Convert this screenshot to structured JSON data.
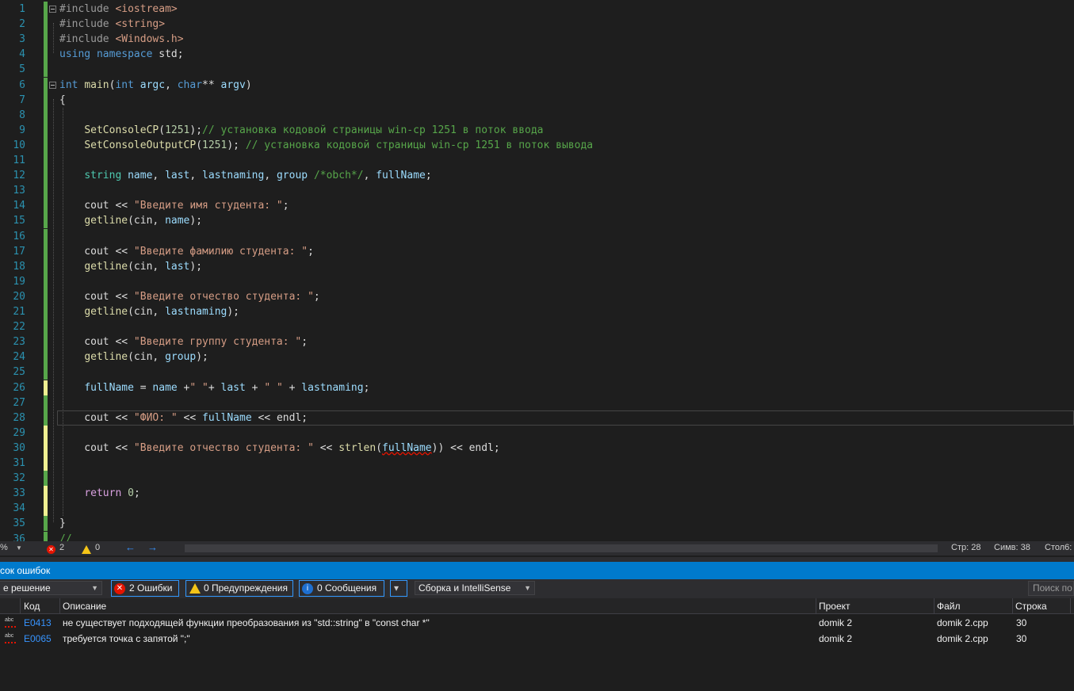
{
  "editor": {
    "lines": [
      {
        "n": "1",
        "html": "<span class=\"pp\">#include</span> <span class=\"str\">&lt;iostream&gt;</span>"
      },
      {
        "n": "2",
        "html": "<span class=\"pp\">#include</span> <span class=\"str\">&lt;string&gt;</span>"
      },
      {
        "n": "3",
        "html": "<span class=\"pp\">#include</span> <span class=\"str\">&lt;Windows.h&gt;</span>"
      },
      {
        "n": "4",
        "html": "<span class=\"kw\">using</span> <span class=\"kw\">namespace</span> std;"
      },
      {
        "n": "5",
        "html": ""
      },
      {
        "n": "6",
        "html": "<span class=\"kw\">int</span> <span class=\"fn\">main</span>(<span class=\"kw\">int</span> <span class=\"var\">argc</span>, <span class=\"kw\">char</span>** <span class=\"var\">argv</span>)"
      },
      {
        "n": "7",
        "html": "{"
      },
      {
        "n": "8",
        "html": ""
      },
      {
        "n": "9",
        "html": "    <span class=\"fn\">SetConsoleCP</span>(<span class=\"num\">1251</span>);<span class=\"cm\">// установка кодовой страницы win-cp 1251 в поток ввода</span>"
      },
      {
        "n": "10",
        "html": "    <span class=\"fn\">SetConsoleOutputCP</span>(<span class=\"num\">1251</span>); <span class=\"cm\">// установка кодовой страницы win-cp 1251 в поток вывода</span>"
      },
      {
        "n": "11",
        "html": ""
      },
      {
        "n": "12",
        "html": "    <span class=\"ty\">string</span> <span class=\"var\">name</span>, <span class=\"var\">last</span>, <span class=\"var\">lastnaming</span>, <span class=\"var\">group</span> <span class=\"cm\">/*obch*/</span>, <span class=\"var\">fullName</span>;"
      },
      {
        "n": "13",
        "html": ""
      },
      {
        "n": "14",
        "html": "    cout &lt;&lt; <span class=\"str\">\"Введите имя студента: \"</span>;"
      },
      {
        "n": "15",
        "html": "    <span class=\"fn\">getline</span>(cin, <span class=\"var\">name</span>);"
      },
      {
        "n": "16",
        "html": ""
      },
      {
        "n": "17",
        "html": "    cout &lt;&lt; <span class=\"str\">\"Введите фамилию студента: \"</span>;"
      },
      {
        "n": "18",
        "html": "    <span class=\"fn\">getline</span>(cin, <span class=\"var\">last</span>);"
      },
      {
        "n": "19",
        "html": ""
      },
      {
        "n": "20",
        "html": "    cout &lt;&lt; <span class=\"str\">\"Введите отчество студента: \"</span>;"
      },
      {
        "n": "21",
        "html": "    <span class=\"fn\">getline</span>(cin, <span class=\"var\">lastnaming</span>);"
      },
      {
        "n": "22",
        "html": ""
      },
      {
        "n": "23",
        "html": "    cout &lt;&lt; <span class=\"str\">\"Введите группу студента: \"</span>;"
      },
      {
        "n": "24",
        "html": "    <span class=\"fn\">getline</span>(cin, <span class=\"var\">group</span>);"
      },
      {
        "n": "25",
        "html": ""
      },
      {
        "n": "26",
        "html": "    <span class=\"var\">fullName</span> = <span class=\"var\">name</span> +<span class=\"str\">\" \"</span>+ <span class=\"var\">last</span> + <span class=\"str\">\" \"</span> + <span class=\"var\">lastnaming</span>;"
      },
      {
        "n": "27",
        "html": ""
      },
      {
        "n": "28",
        "html": "    cout &lt;&lt; <span class=\"str\">\"ФИО: \"</span> &lt;&lt; <span class=\"var\">fullName</span> &lt;&lt; endl;"
      },
      {
        "n": "29",
        "html": ""
      },
      {
        "n": "30",
        "html": "    cout &lt;&lt; <span class=\"str\">\"Введите отчество студента: \"</span> &lt;&lt; <span class=\"fn\">strlen</span>(<span class=\"var squig\">fullName</span>)) &lt;&lt; endl;"
      },
      {
        "n": "31",
        "html": ""
      },
      {
        "n": "32",
        "html": ""
      },
      {
        "n": "33",
        "html": "    <span class=\"ctl\">return</span> <span class=\"num\">0</span>;"
      },
      {
        "n": "34",
        "html": ""
      },
      {
        "n": "35",
        "html": "}"
      },
      {
        "n": "36",
        "html": "<span class=\"cm\">//</span>"
      }
    ]
  },
  "statusbar": {
    "zoom": "%",
    "errors": "2",
    "warnings": "0",
    "line": "Стр: 28",
    "char": "Симв: 38",
    "col": "Стол6:"
  },
  "panel": {
    "title": "сок ошибок",
    "scope": "е решение",
    "errors_btn": "2 Ошибки",
    "warnings_btn": "0 Предупреждения",
    "messages_btn": "0 Сообщения",
    "build_filter": "Сборка и IntelliSense",
    "search_placeholder": "Поиск по",
    "columns": {
      "code": "Код",
      "desc": "Описание",
      "project": "Проект",
      "file": "Файл",
      "line": "Строка"
    },
    "rows": [
      {
        "code": "E0413",
        "desc": "не существует подходящей функции преобразования из \"std::string\" в \"const char *\"",
        "project": "domik 2",
        "file": "domik 2.cpp",
        "line": "30"
      },
      {
        "code": "E0065",
        "desc": "требуется точка с запятой \";\"",
        "project": "domik 2",
        "file": "domik 2.cpp",
        "line": "30"
      }
    ]
  },
  "colors": {
    "accent": "#007acc",
    "error": "#e51400",
    "warning": "#f5c518"
  }
}
